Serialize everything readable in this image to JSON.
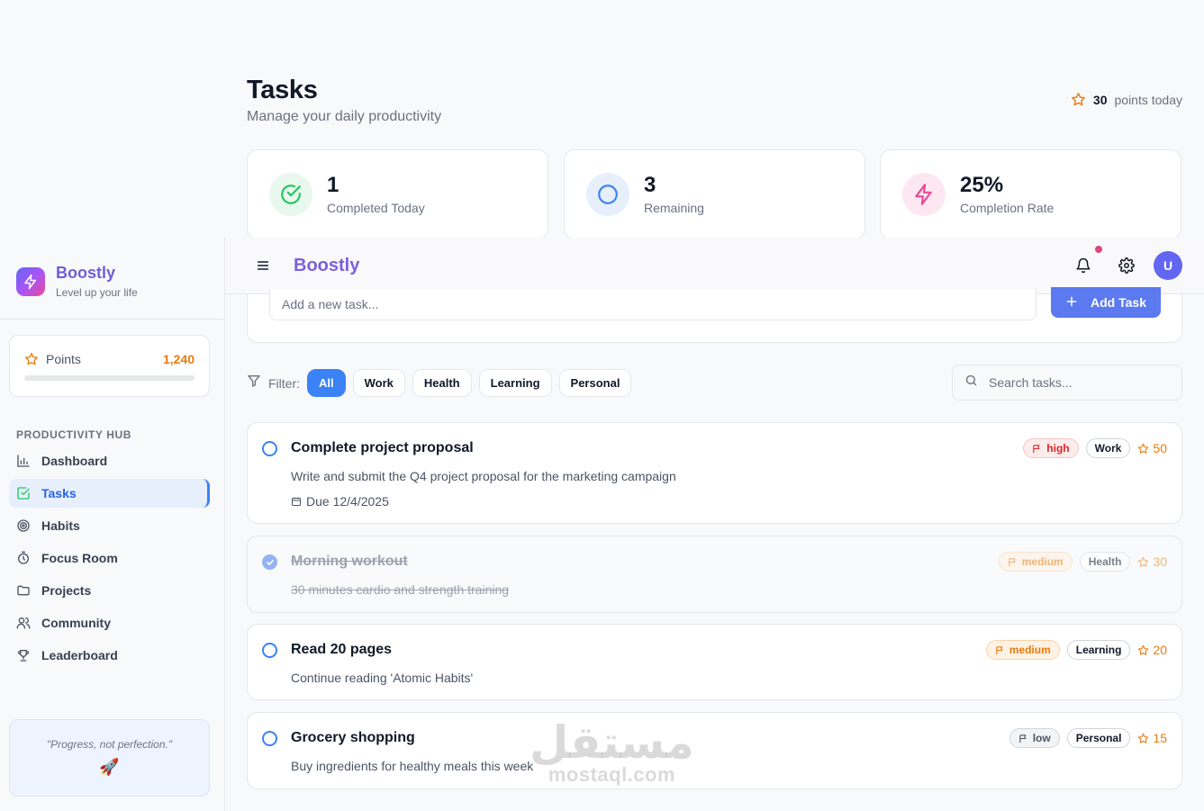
{
  "header": {
    "title": "Tasks",
    "subtitle": "Manage your daily productivity",
    "points_today_value": "30",
    "points_today_label": "points today"
  },
  "stats": [
    {
      "value": "1",
      "label": "Completed Today",
      "icon": "check-circle-icon",
      "color": "#22c55e"
    },
    {
      "value": "3",
      "label": "Remaining",
      "icon": "circle-icon",
      "color": "#3b82f6"
    },
    {
      "value": "25%",
      "label": "Completion Rate",
      "icon": "lightning-icon",
      "color": "#ec4899"
    }
  ],
  "sidebar": {
    "brand_name": "Boostly",
    "brand_tagline": "Level up your life",
    "points_label": "Points",
    "points_value": "1,240",
    "points_progress": 0,
    "section_title": "PRODUCTIVITY HUB",
    "items": [
      {
        "label": "Dashboard",
        "icon": "bar-chart-icon"
      },
      {
        "label": "Tasks",
        "icon": "checkbox-icon",
        "active": true
      },
      {
        "label": "Habits",
        "icon": "target-icon"
      },
      {
        "label": "Focus Room",
        "icon": "timer-icon"
      },
      {
        "label": "Projects",
        "icon": "folder-icon"
      },
      {
        "label": "Community",
        "icon": "users-icon"
      },
      {
        "label": "Leaderboard",
        "icon": "trophy-icon"
      }
    ],
    "quote": "\"Progress, not perfection.\"",
    "quote_emoji": "🚀"
  },
  "topbar": {
    "app_name": "Boostly",
    "avatar_initial": "U"
  },
  "add_task": {
    "placeholder": "Add a new task...",
    "button_label": "Add Task"
  },
  "filter": {
    "label": "Filter:",
    "options": [
      "All",
      "Work",
      "Health",
      "Learning",
      "Personal"
    ],
    "selected": "All",
    "search_placeholder": "Search tasks..."
  },
  "tasks": [
    {
      "title": "Complete project proposal",
      "description": "Write and submit the Q4 project proposal for the marketing campaign",
      "due": "Due 12/4/2025",
      "priority": "high",
      "category": "Work",
      "points": "50",
      "completed": false
    },
    {
      "title": "Morning workout",
      "description": "30 minutes cardio and strength training",
      "due": "",
      "priority": "medium",
      "category": "Health",
      "points": "30",
      "completed": true
    },
    {
      "title": "Read 20 pages",
      "description": "Continue reading 'Atomic Habits'",
      "due": "",
      "priority": "medium",
      "category": "Learning",
      "points": "20",
      "completed": false
    },
    {
      "title": "Grocery shopping",
      "description": "Buy ingredients for healthy meals this week",
      "due": "",
      "priority": "low",
      "category": "Personal",
      "points": "15",
      "completed": false
    }
  ],
  "watermark": {
    "arabic": "مستقل",
    "latin": "mostaql.com"
  },
  "colors": {
    "primary": "#3b82f6",
    "brand": "#7c5fdc",
    "points": "#ea7a0c",
    "danger": "#dc2626"
  }
}
